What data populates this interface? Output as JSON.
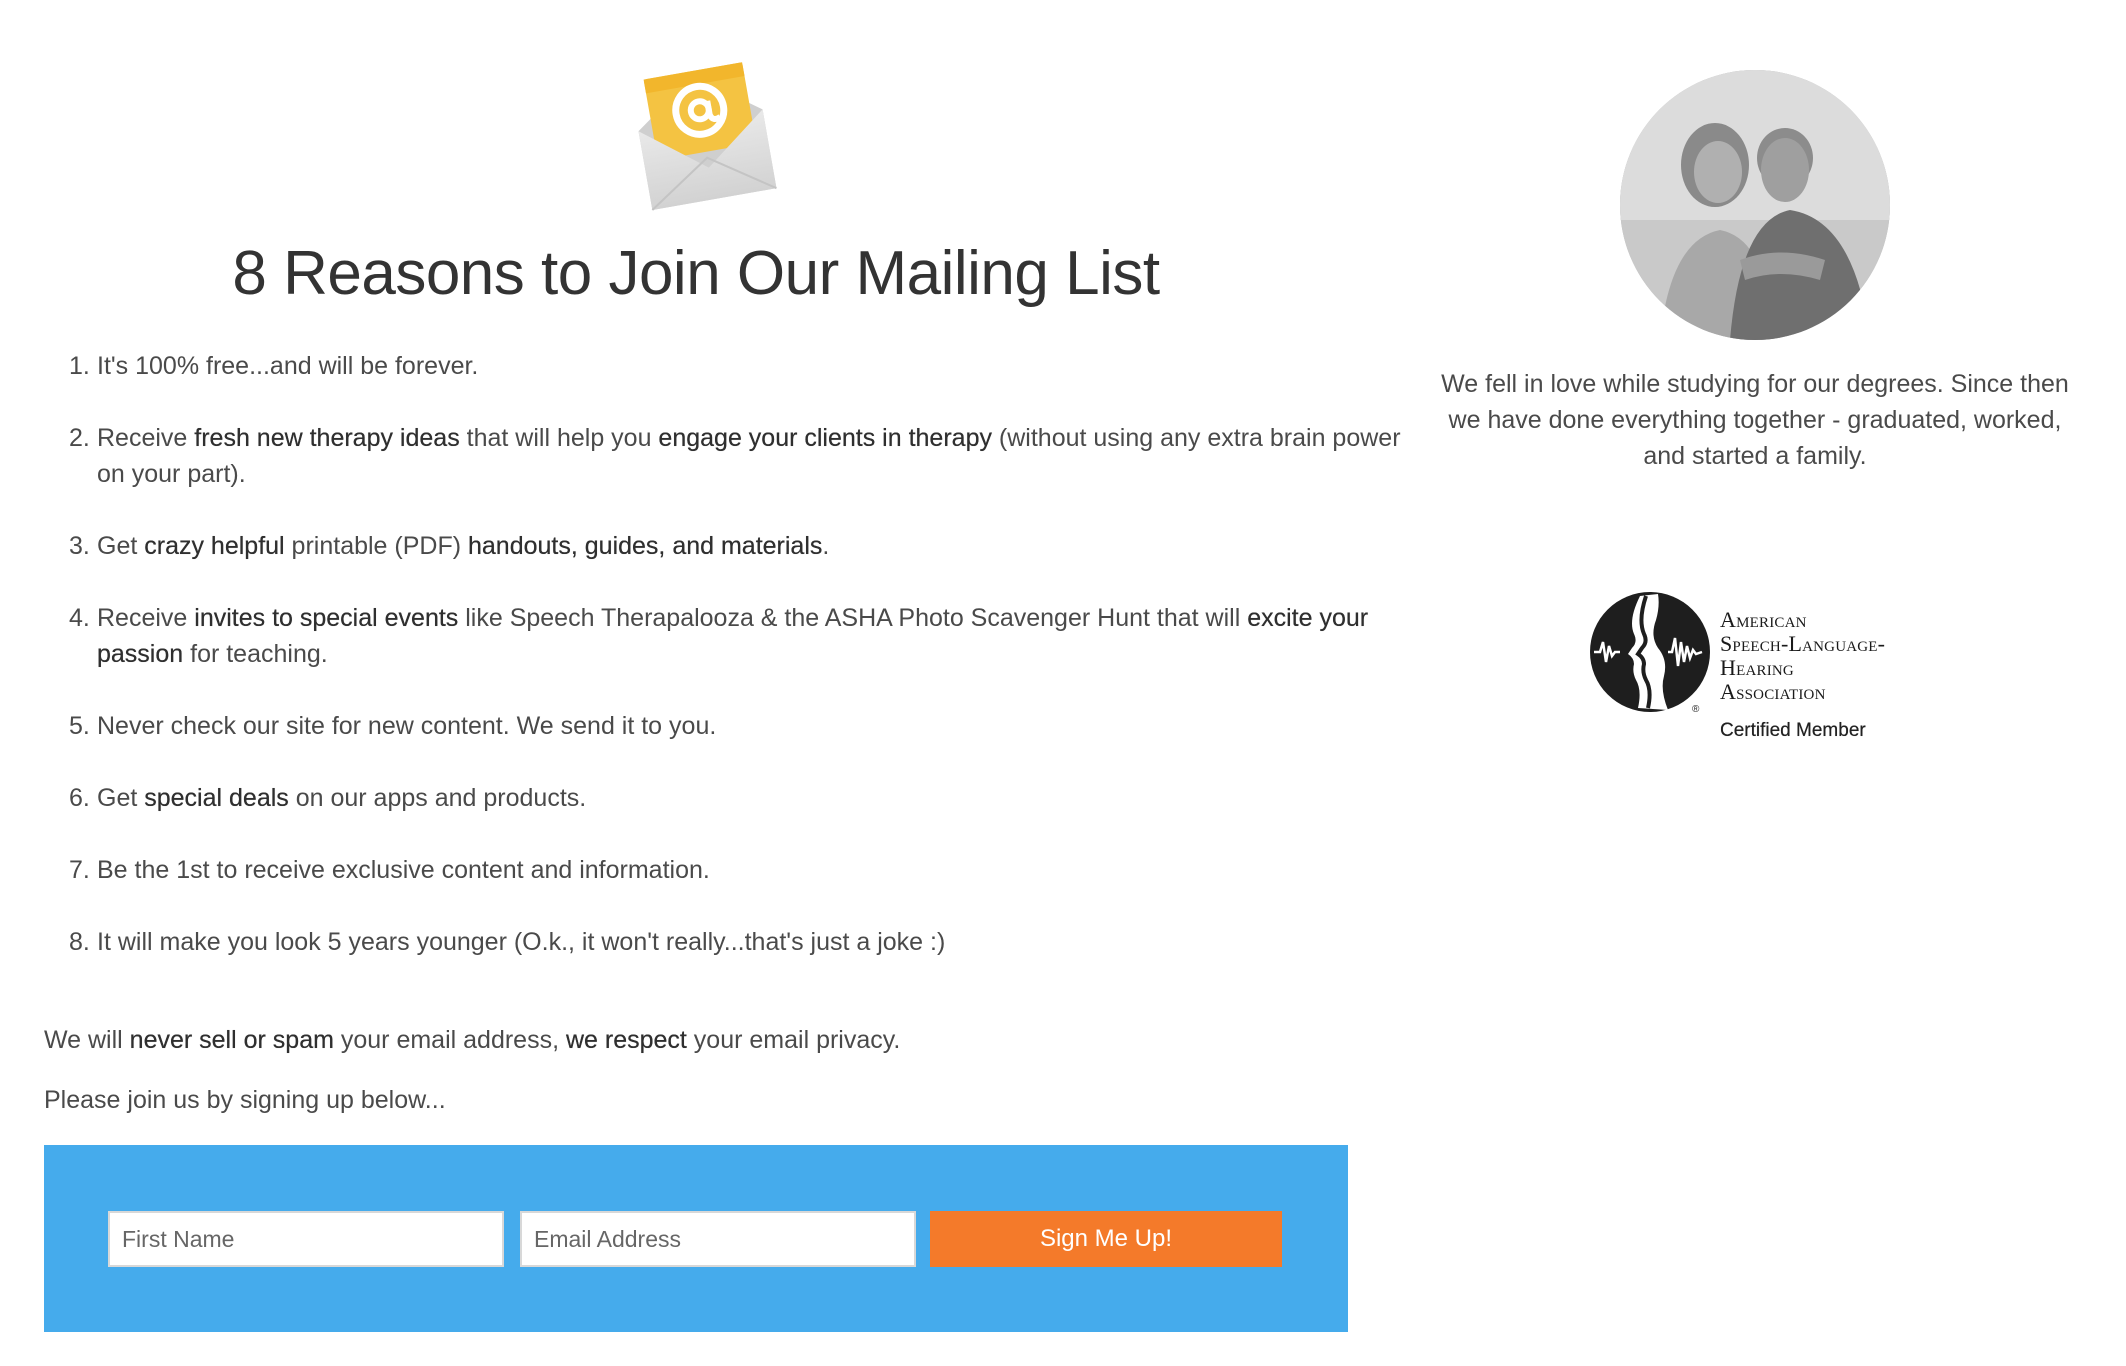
{
  "headline": "8 Reasons to Join Our Mailing List",
  "reasons": [
    {
      "num": "1.",
      "parts": [
        {
          "t": "It's 100% free...and will be forever.",
          "b": false
        }
      ]
    },
    {
      "num": "2.",
      "parts": [
        {
          "t": "Receive ",
          "b": false
        },
        {
          "t": "fresh new therapy ideas",
          "b": true
        },
        {
          "t": " that will help you ",
          "b": false
        },
        {
          "t": "engage your clients in therapy",
          "b": true
        },
        {
          "t": " (without using any extra brain power on your part).",
          "b": false
        }
      ]
    },
    {
      "num": "3.",
      "parts": [
        {
          "t": "Get ",
          "b": false
        },
        {
          "t": "crazy helpful",
          "b": true
        },
        {
          "t": " printable (PDF) ",
          "b": false
        },
        {
          "t": "handouts, guides, and materials",
          "b": true
        },
        {
          "t": ".",
          "b": false
        }
      ]
    },
    {
      "num": "4.",
      "parts": [
        {
          "t": "Receive ",
          "b": false
        },
        {
          "t": "invites to special events",
          "b": true
        },
        {
          "t": " like Speech Therapalooza & the ASHA Photo Scavenger Hunt that will ",
          "b": false
        },
        {
          "t": "excite your passion",
          "b": true
        },
        {
          "t": " for teaching.",
          "b": false
        }
      ]
    },
    {
      "num": "5.",
      "parts": [
        {
          "t": "Never check our site for new content. We send it to you.",
          "b": false
        }
      ]
    },
    {
      "num": "6.",
      "parts": [
        {
          "t": "Get ",
          "b": false
        },
        {
          "t": "special deals",
          "b": true
        },
        {
          "t": " on our apps and products.",
          "b": false
        }
      ]
    },
    {
      "num": "7.",
      "parts": [
        {
          "t": "Be the 1st to receive exclusive content and information.",
          "b": false
        }
      ]
    },
    {
      "num": "8.",
      "parts": [
        {
          "t": "It will make you look 5 years younger (O.k., it won't really...that's just a joke :)",
          "b": false
        }
      ]
    }
  ],
  "privacy": {
    "p1": "We will ",
    "b1": "never sell or spam",
    "p2": " your email address, ",
    "b2": "we respect",
    "p3": " your email privacy."
  },
  "join_text": "Please join us by signing up below...",
  "form": {
    "first_name_placeholder": "First Name",
    "email_placeholder": "Email Address",
    "submit_label": "Sign Me Up!"
  },
  "bio": "We fell in love while studying for our degrees. Since then we have done everything together - graduated, worked, and started a family.",
  "asha": {
    "line1": "American",
    "line2": "Speech-Language-",
    "line3": "Hearing",
    "line4": "Association",
    "certified": "Certified Member"
  },
  "colors": {
    "signup_bg": "#45abec",
    "button_bg": "#f47a2a",
    "envelope_yellow": "#f4c342"
  },
  "icons": [
    "email-envelope-icon",
    "asha-logo-icon"
  ]
}
